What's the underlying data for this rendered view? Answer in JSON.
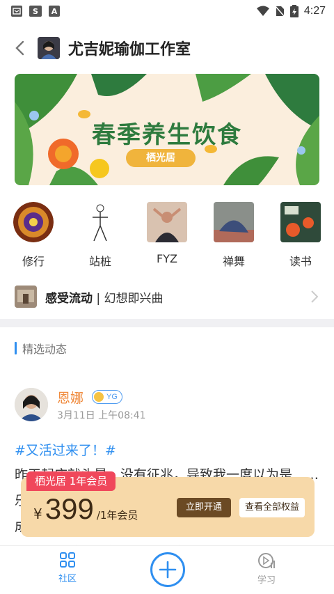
{
  "status_bar": {
    "time": "4:27",
    "icons": [
      "notification-icon",
      "s-app-icon",
      "a-app-icon",
      "wifi-icon",
      "no-sim-icon",
      "battery-icon"
    ]
  },
  "header": {
    "title": "尤吉妮瑜伽工作室",
    "back_icon": "chevron-left-icon"
  },
  "banner": {
    "title": "春季养生饮食",
    "pill": "栖光居"
  },
  "categories": [
    {
      "label": "修行"
    },
    {
      "label": "站桩"
    },
    {
      "label": "FYZ"
    },
    {
      "label": "禅舞"
    },
    {
      "label": "读书"
    }
  ],
  "recommend": {
    "bold": "感受流动",
    "separator": " | ",
    "rest": "幻想即兴曲"
  },
  "section": {
    "title": "精选动态"
  },
  "post": {
    "author": "恩娜",
    "badge": "YG",
    "time": "3月11日 上午08:41",
    "tag": "#又活过来了！#",
    "body": "昨天起床就头晕，没有征兆，导致我一度以为是……乐\n成\n因骨帮我按揉背部松解，稳定筋骨，使感触觉"
  },
  "membership": {
    "tag": "栖光居 1年会员",
    "yen": "¥",
    "price": "399",
    "unit": "/1年会员",
    "open_button": "立即开通",
    "all_button": "查看全部权益"
  },
  "nav": {
    "community": "社区",
    "study": "学习"
  },
  "colors": {
    "accent": "#2f8ff0",
    "author": "#f08a3c",
    "member_bg": "#f7d9a9",
    "member_tag": "#f0475b"
  }
}
